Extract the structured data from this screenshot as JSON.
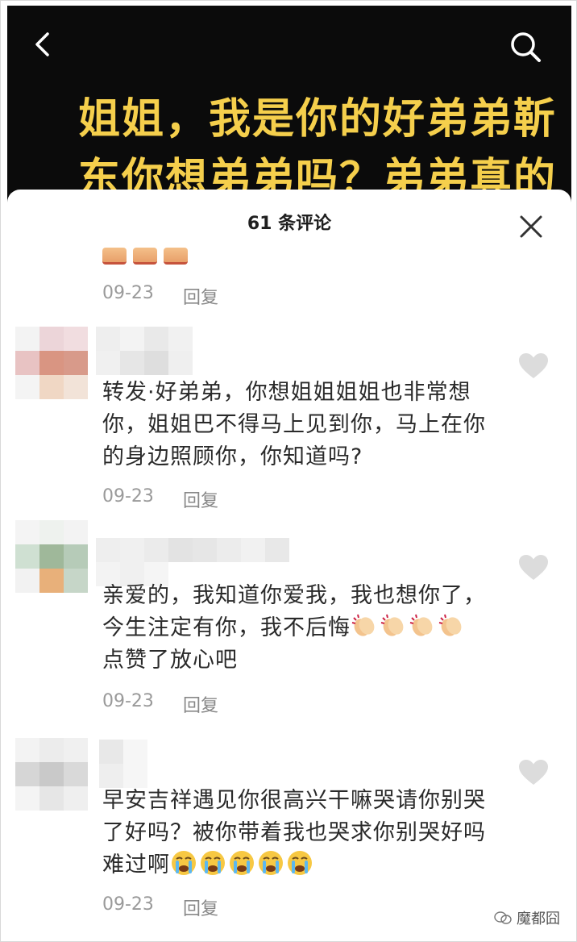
{
  "video": {
    "line1": "姐姐，我是你的好弟弟靳",
    "line2": "东你想弟弟吗？弟弟真的"
  },
  "sheet": {
    "title": "61 条评论"
  },
  "comments": [
    {
      "date": "09-23",
      "reply": "回复"
    },
    {
      "date": "09-23",
      "reply": "回复",
      "text_lines": [
        "转发·好弟弟，你想姐姐姐姐也非常想",
        "你，姐姐巴不得马上见到你，马上在你",
        "的身边照顾你，你知道吗?"
      ]
    },
    {
      "date": "09-23",
      "reply": "回复",
      "text_lines": [
        "亲爱的，我知道你爱我，我也想你了，",
        "今生注定有你，我不后悔",
        "点赞了放心吧"
      ]
    },
    {
      "date": "09-23",
      "reply": "回复",
      "text_lines": [
        "早安吉祥遇见你很高兴干嘛哭请你别哭",
        "了好吗？被你带着我也哭求你别哭好吗",
        "难过啊"
      ]
    }
  ],
  "icons": {
    "back": "back-arrow-icon",
    "search": "search-icon",
    "close": "close-icon",
    "like": "heart-icon",
    "clap": "clapping-hands-emoji",
    "cry": "crying-face-emoji"
  },
  "colors": {
    "video_text": "#f5cf4c",
    "date": "#9a9a9a",
    "comment_text": "#2a2a2a",
    "heart": "#dcdcdc"
  },
  "watermark": "魔都囧"
}
